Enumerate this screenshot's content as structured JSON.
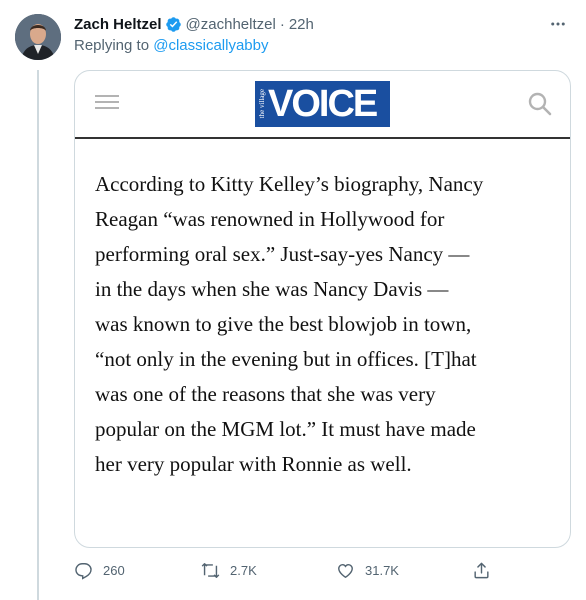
{
  "tweet": {
    "display_name": "Zach Heltzel",
    "handle": "@zachheltzel",
    "separator": "·",
    "time": "22h",
    "more_icon": "more-horizontal-icon",
    "reply_prefix": "Replying to",
    "reply_to": "@classicallyabby"
  },
  "media": {
    "logo_small": "the village",
    "logo_big": "VOICE",
    "article_lines": [
      "According to Kitty Kelley’s biography, Nancy",
      "Reagan “was renowned in Hollywood for",
      "performing oral sex.” Just-say-yes Nancy —",
      "in the days when she was Nancy Davis —",
      "was known to give the best blowjob in town,",
      "“not only in the evening but in offices. [T]hat",
      "was one of the reasons that she was very",
      "popular on the MGM lot.” It must have made",
      "her very popular with Ronnie as well."
    ]
  },
  "actions": {
    "replies": "260",
    "retweets": "2.7K",
    "likes": "31.7K"
  },
  "colors": {
    "accent": "#1d9bf0",
    "secondary_text": "#536471",
    "logo_blue": "#1a4fa0",
    "border": "#cfd9de"
  }
}
